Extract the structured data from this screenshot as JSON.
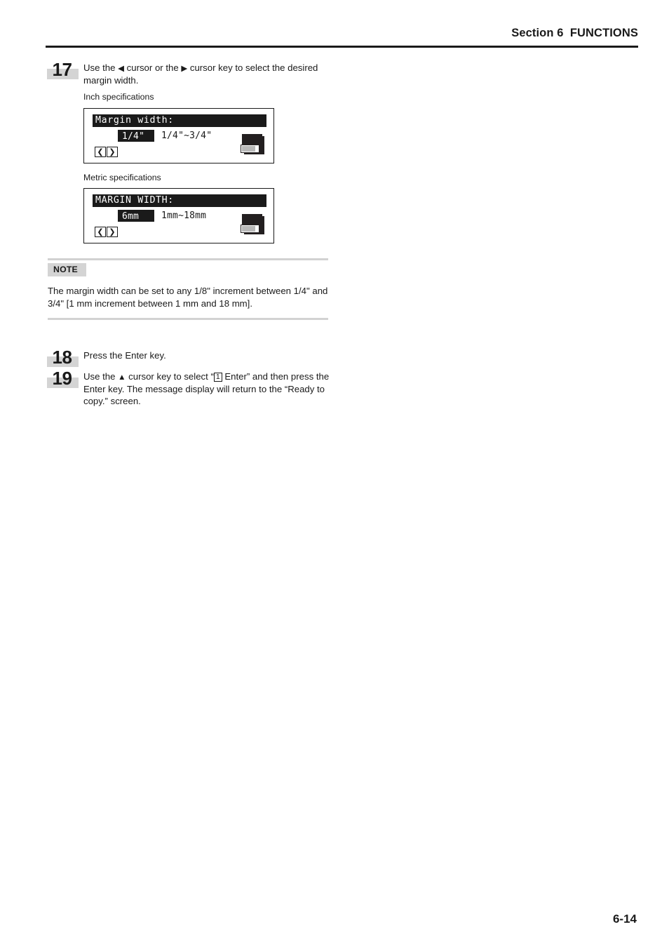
{
  "header": {
    "title": "Section 6  FUNCTIONS"
  },
  "steps": [
    {
      "number": "17",
      "text_before_left": "Use the ",
      "left_arrow": "◀",
      "text_mid": " cursor or the ",
      "right_arrow": "▶",
      "text_after": " cursor key to select the desired margin width."
    },
    {
      "number": "18",
      "text": "Press the Enter key."
    },
    {
      "number": "19",
      "text_before_up": "Use the ",
      "up_arrow": "▲",
      "text_mid": " cursor key to select “",
      "boxed_key": "1",
      "text_after": " Enter” and then press the Enter key. The message display will return to the “Ready to copy.” screen."
    }
  ],
  "panels": [
    {
      "caption": "Inch specifications",
      "title": "Margin width:",
      "value": "1/4\"",
      "range": "1/4\"~3/4\"",
      "left_key": "❮",
      "right_key": "❯",
      "icon": "drum-cartridge-icon"
    },
    {
      "caption": "Metric specifications",
      "title": "MARGIN WIDTH:",
      "value": "6mm",
      "range": "1mm~18mm",
      "left_key": "❮",
      "right_key": "❯",
      "icon": "drum-cartridge-icon"
    }
  ],
  "note": {
    "label": "NOTE",
    "text": "The margin width can be set to any 1/8\" increment between 1/4\" and 3/4\" [1 mm increment between 1 mm and 18 mm]."
  },
  "footer": {
    "page_number": "6-14"
  },
  "colors": {
    "text": "#1a1a1a",
    "badge_gray": "#d4d4d4",
    "rule_gray": "#d2d2d2",
    "lcd_black": "#1a1a1a"
  }
}
